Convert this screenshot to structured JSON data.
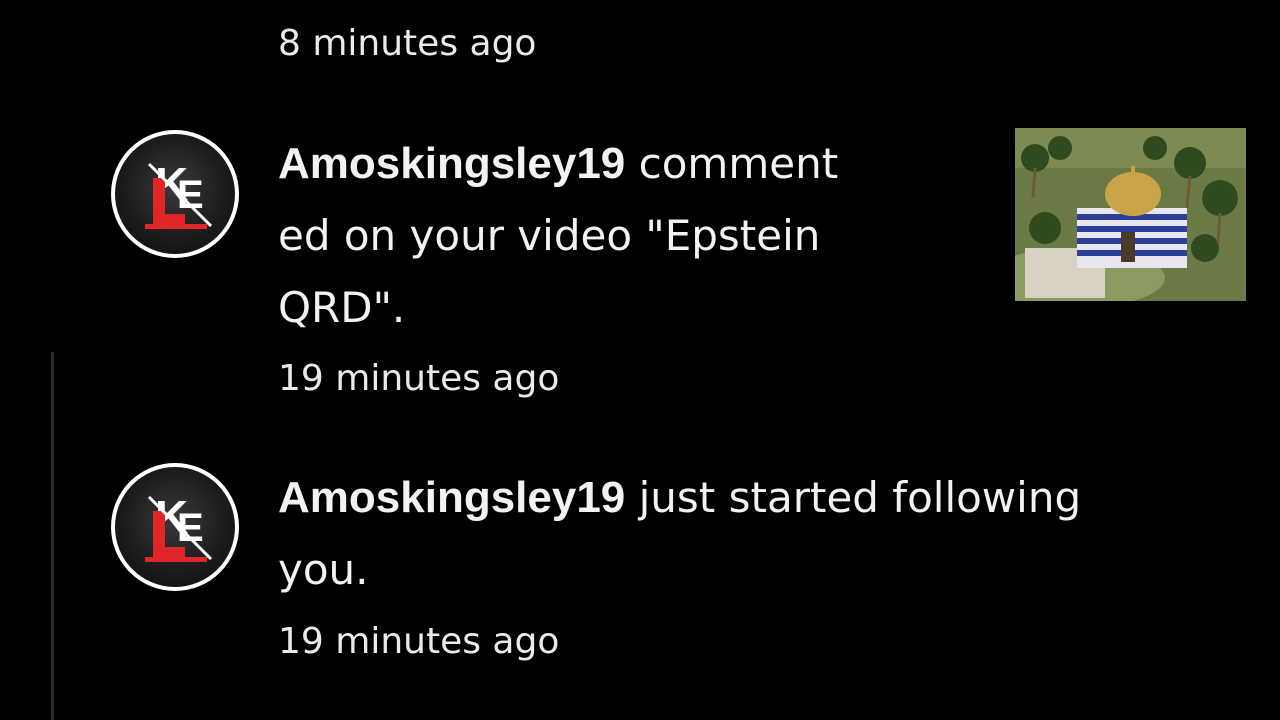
{
  "previous_item": {
    "time": "8 minutes ago"
  },
  "notifications": [
    {
      "username": "Amoskingsley19",
      "line1_rest": " comment",
      "line2": "ed on your video \"Epstein",
      "line3": "QRD\".",
      "time": "19 minutes ago",
      "avatar_icon": "ke-logo-avatar",
      "thumbnail_icon": "video-thumbnail-island-temple"
    },
    {
      "username": "Amoskingsley19",
      "line1_rest": " just started following",
      "line2": "you.",
      "time": "19 minutes ago",
      "avatar_icon": "ke-logo-avatar"
    }
  ],
  "colors": {
    "background": "#000000",
    "text": "#f2f2f2",
    "logo_red": "#e0262b"
  }
}
